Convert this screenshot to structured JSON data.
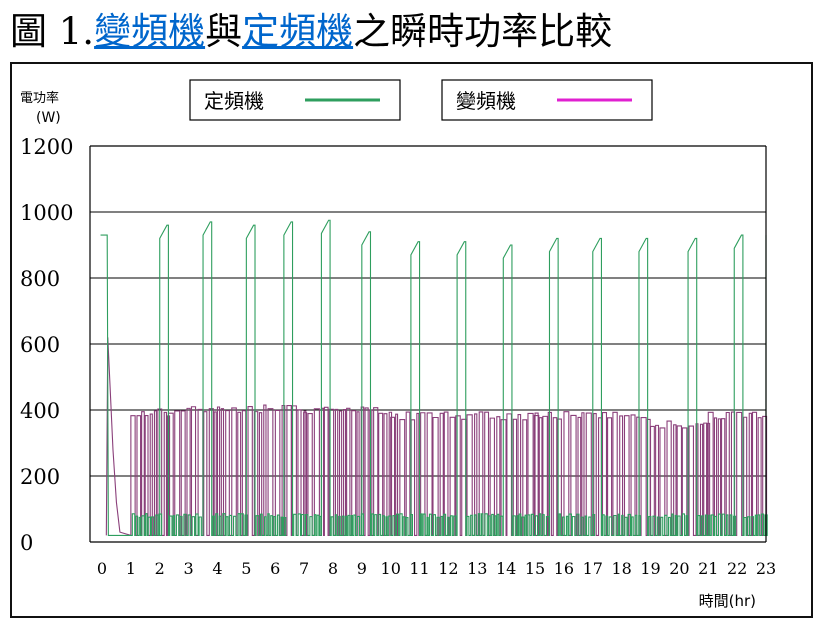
{
  "title": {
    "prefix": "圖 1.",
    "link1": "變頻機",
    "mid": "與",
    "link2": "定頻機",
    "suffix": "之瞬時功率比較"
  },
  "colors": {
    "fixed": "#2e9e5e",
    "inverter_legend": "#e020d0",
    "inverter_bars": "#8a3f7a",
    "grid": "#000000",
    "link": "#0066cc"
  },
  "chart_data": {
    "type": "line",
    "ylabel": "電功率",
    "yunit": "(W)",
    "xlabel": "時間(hr)",
    "ylim": [
      0,
      1200
    ],
    "yticks": [
      0,
      200,
      400,
      600,
      800,
      1000,
      1200
    ],
    "xlim": [
      0,
      23
    ],
    "xticks": [
      0,
      1,
      2,
      3,
      4,
      5,
      6,
      7,
      8,
      9,
      10,
      11,
      12,
      13,
      14,
      15,
      16,
      17,
      18,
      19,
      20,
      21,
      22,
      23
    ],
    "grid": true,
    "legend_position": "top",
    "series": [
      {
        "name": "定頻機",
        "color": "#2e9e5e",
        "baseline_w": 80,
        "start_w": 930,
        "peak_times_hr": [
          2.3,
          3.8,
          5.3,
          6.6,
          7.9,
          9.3,
          11.0,
          12.6,
          14.2,
          15.8,
          17.3,
          18.9,
          20.6,
          22.2
        ],
        "peak_values_w": [
          960,
          970,
          960,
          970,
          975,
          940,
          910,
          910,
          900,
          920,
          920,
          920,
          920,
          930
        ]
      },
      {
        "name": "變頻機",
        "color": "#e020d0",
        "startup_peak_w": 620,
        "cycling_w": [
          {
            "from_hr": 1.0,
            "to_hr": 2.3,
            "high": 405,
            "low": 20
          },
          {
            "from_hr": 2.3,
            "to_hr": 4.0,
            "high": 410,
            "low": 20
          },
          {
            "from_hr": 4.0,
            "to_hr": 7.0,
            "high": 415,
            "low": 20
          },
          {
            "from_hr": 7.0,
            "to_hr": 10.0,
            "high": 410,
            "low": 20
          },
          {
            "from_hr": 10.0,
            "to_hr": 15.0,
            "high": 395,
            "low": 20
          },
          {
            "from_hr": 15.0,
            "to_hr": 19.0,
            "high": 395,
            "low": 20
          },
          {
            "from_hr": 19.0,
            "to_hr": 21.0,
            "high": 370,
            "low": 20
          },
          {
            "from_hr": 21.0,
            "to_hr": 23.0,
            "high": 395,
            "low": 20
          }
        ]
      }
    ]
  }
}
